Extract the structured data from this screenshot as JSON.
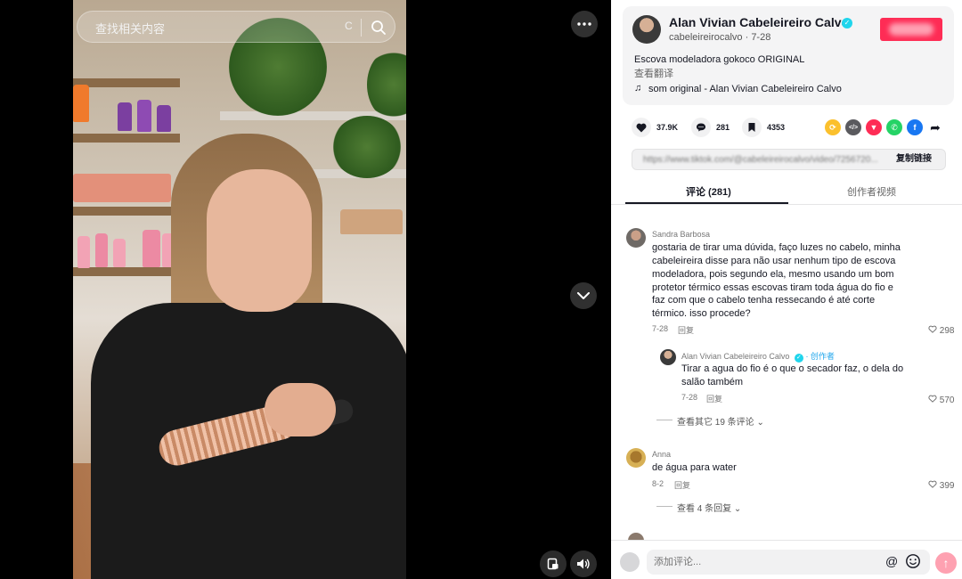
{
  "search": {
    "placeholder": "查找相关内容",
    "clear_label": "C"
  },
  "author": {
    "name": "Alan Vivian Cabeleireiro Calvo",
    "handle_date": "cabeleireirocalvo · 7-28",
    "description": "Escova modeladora gokoco ORIGINAL",
    "translate": "查看翻译",
    "music": "som original - Alan Vivian Cabeleireiro Calvo"
  },
  "stats": {
    "likes": "37.9K",
    "comments": "281",
    "saves": "4353"
  },
  "share_icons": [
    {
      "name": "repost-icon",
      "color": "#fbc02d"
    },
    {
      "name": "embed-icon",
      "color": "#5a5a5e"
    },
    {
      "name": "send-icon",
      "color": "#fe2c55"
    },
    {
      "name": "whatsapp-icon",
      "color": "#25d366"
    },
    {
      "name": "facebook-icon",
      "color": "#1877f2"
    },
    {
      "name": "share-arrow-icon",
      "color": "#161823"
    }
  ],
  "link": {
    "url": "https://www.tiktok.com/@cabeleireirocalvo/video/7256720...",
    "copy_label": "复制链接"
  },
  "tabs": {
    "comments": "评论 (281)",
    "creator_videos": "创作者视频"
  },
  "comments": [
    {
      "user": "Sandra Barbosa",
      "text_lines": [
        "gostaria de tirar uma dúvida, faço luzes no cabelo, minha",
        "cabeleireira disse para não usar nenhum tipo de escova",
        "modeladora, pois segundo ela, mesmo usando um bom",
        "protetor térmico essas escovas tiram toda água do fio e",
        "faz com que o cabelo tenha ressecando é até corte",
        "térmico. isso procede?"
      ],
      "date": "7-28",
      "reply": "回复",
      "likes": "298",
      "replies": [
        {
          "user": "Alan Vivian Cabeleireiro Calvo",
          "badge": "· 创作者",
          "text_lines": [
            "Tirar a agua do fio é o que o secador faz, o dela do",
            "salão também"
          ],
          "date": "7-28",
          "reply": "回复",
          "likes": "570"
        }
      ],
      "more_replies": "查看其它 19 条评论"
    },
    {
      "user": "Anna",
      "text_lines": [
        "de água para water"
      ],
      "date": "8-2",
      "reply": "回复",
      "likes": "399",
      "more_replies": "查看 4 条回复"
    }
  ],
  "comment_input": {
    "placeholder": "添加评论..."
  }
}
